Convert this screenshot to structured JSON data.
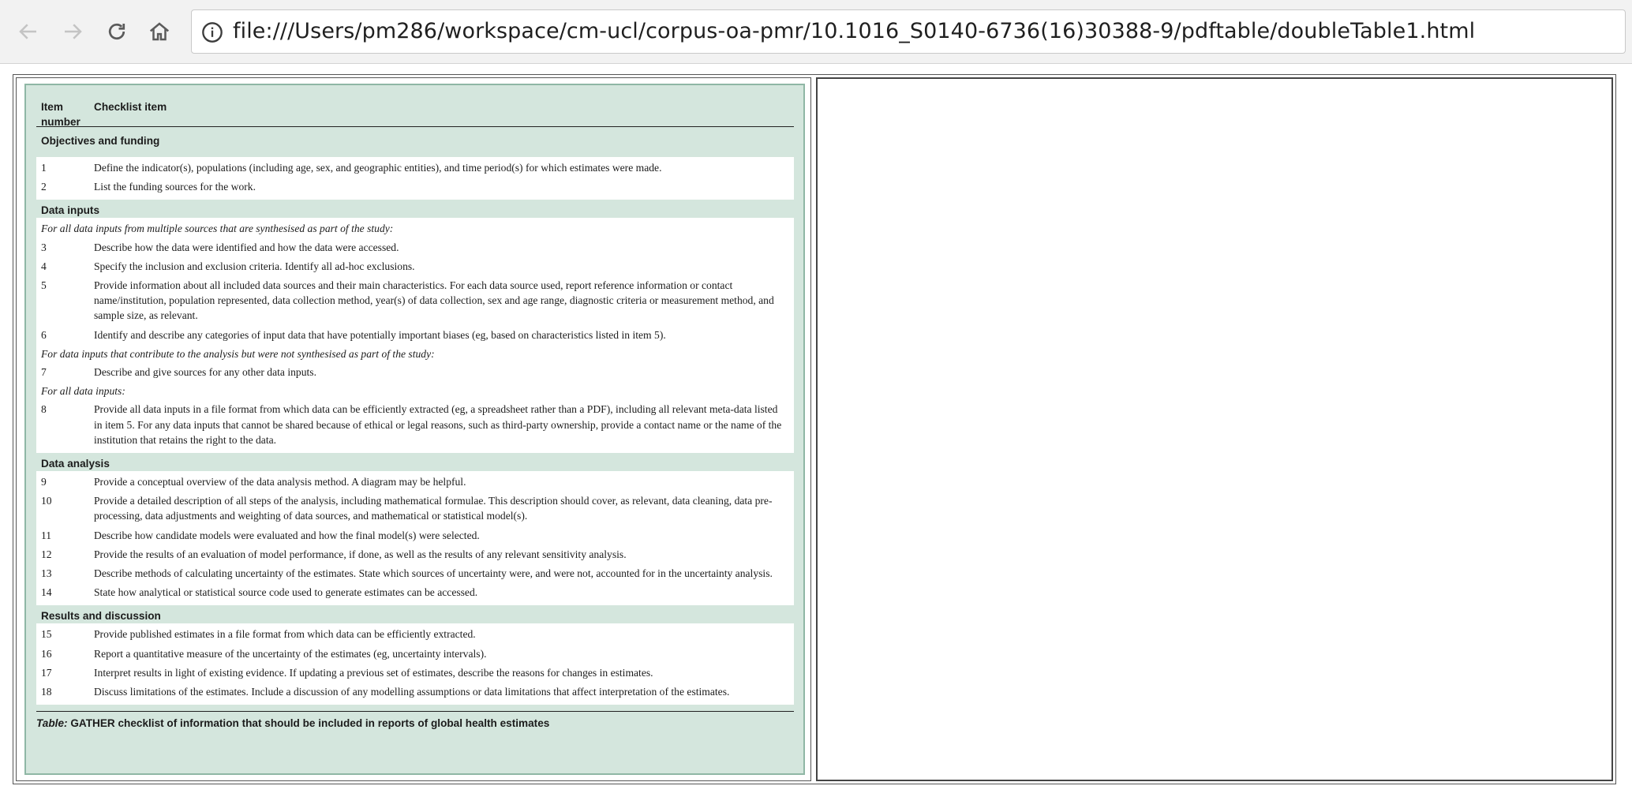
{
  "browser": {
    "url": "file:///Users/pm286/workspace/cm-ucl/corpus-oa-pmr/10.1016_S0140-6736(16)30388-9/pdftable/doubleTable1.html",
    "icons": [
      "back-arrow-icon",
      "forward-arrow-icon",
      "reload-icon",
      "home-icon",
      "info-icon"
    ]
  },
  "table": {
    "header": {
      "col1_line1": "Item",
      "col1_line2": "number",
      "col2": "Checklist item"
    },
    "sections": [
      {
        "title": "Objectives and funding",
        "rows": [
          {
            "type": "item",
            "num": "1",
            "text": "Define the indicator(s), populations (including age, sex, and geographic entities), and time period(s) for which estimates were made."
          },
          {
            "type": "item",
            "num": "2",
            "text": "List the funding sources for the work."
          }
        ]
      },
      {
        "title": "Data inputs",
        "rows": [
          {
            "type": "note",
            "text": "For all data inputs from multiple sources that are synthesised as part of the study:"
          },
          {
            "type": "item",
            "num": "3",
            "text": "Describe how the data were identified and how the data were accessed."
          },
          {
            "type": "item",
            "num": "4",
            "text": "Specify the inclusion and exclusion criteria. Identify all ad-hoc exclusions."
          },
          {
            "type": "item",
            "num": "5",
            "text": "Provide information about all included data sources and their main characteristics. For each data source used, report reference information or contact name/institution, population represented, data collection method, year(s) of data collection, sex and age range, diagnostic criteria or measurement method, and sample size, as relevant."
          },
          {
            "type": "item",
            "num": "6",
            "text": "Identify and describe any categories of input data that have potentially important biases (eg, based on characteristics listed in item 5)."
          },
          {
            "type": "note",
            "text": "For data inputs that contribute to the analysis but were not synthesised as part of the study:"
          },
          {
            "type": "item",
            "num": "7",
            "text": "Describe and give sources for any other data inputs."
          },
          {
            "type": "note",
            "text": "For all data inputs:"
          },
          {
            "type": "item",
            "num": "8",
            "text": "Provide all data inputs in a file format from which data can be efficiently extracted (eg, a spreadsheet rather than a PDF), including all relevant meta-data listed in item 5. For any data inputs that cannot be shared because of ethical or legal reasons, such as third-party ownership, provide a contact name or the name of the institution that retains the right to the data."
          }
        ]
      },
      {
        "title": "Data analysis",
        "rows": [
          {
            "type": "item",
            "num": "9",
            "text": "Provide a conceptual overview of the data analysis method. A diagram may be helpful."
          },
          {
            "type": "item",
            "num": "10",
            "text": "Provide a detailed description of all steps of the analysis, including mathematical formulae. This description should cover, as relevant, data cleaning, data pre-processing, data adjustments and weighting of data sources, and mathematical or statistical model(s)."
          },
          {
            "type": "item",
            "num": "11",
            "text": "Describe how candidate models were evaluated and how the final model(s) were selected."
          },
          {
            "type": "item",
            "num": "12",
            "text": "Provide the results of an evaluation of model performance, if done, as well as the results of any relevant sensitivity analysis."
          },
          {
            "type": "item",
            "num": "13",
            "text": "Describe methods of calculating uncertainty of the estimates. State which sources of uncertainty were, and were not, accounted for in the uncertainty analysis."
          },
          {
            "type": "item",
            "num": "14",
            "text": "State how analytical or statistical source code used to generate estimates can be accessed."
          }
        ]
      },
      {
        "title": "Results and discussion",
        "rows": [
          {
            "type": "item",
            "num": "15",
            "text": "Provide published estimates in a file format from which data can be efficiently extracted."
          },
          {
            "type": "item",
            "num": "16",
            "text": "Report a quantitative measure of the uncertainty of the estimates (eg, uncertainty intervals)."
          },
          {
            "type": "item",
            "num": "17",
            "text": "Interpret results in light of existing evidence. If updating a previous set of estimates, describe the reasons for changes in estimates."
          },
          {
            "type": "item",
            "num": "18",
            "text": "Discuss limitations of the estimates. Include a discussion of any modelling assumptions or data limitations that affect interpretation of the estimates."
          }
        ]
      }
    ],
    "caption": {
      "label": "Table:",
      "text": "GATHER checklist of information that should be included in reports of global health estimates"
    }
  },
  "colors": {
    "panel_bg": "#d4e6dd",
    "panel_border": "#8fb7a5",
    "toolbar_bg": "#f2f2f2"
  }
}
